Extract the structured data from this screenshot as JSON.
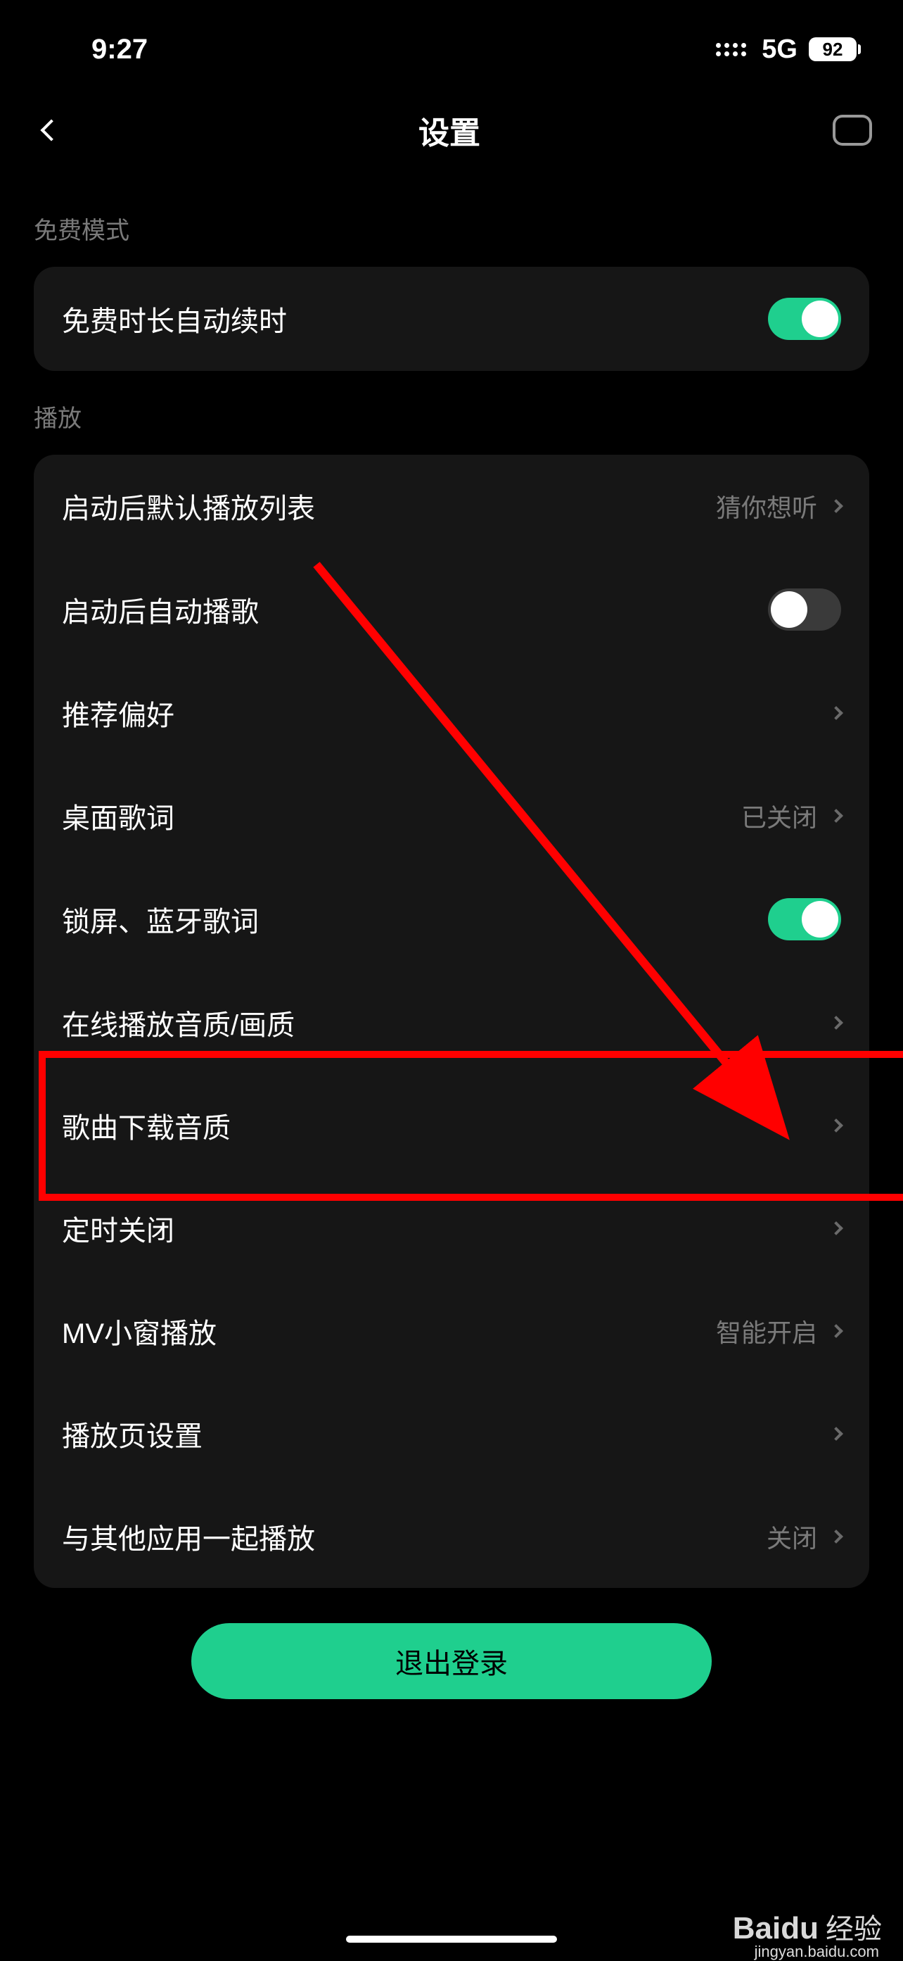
{
  "statusBar": {
    "time": "9:27",
    "network": "5G",
    "battery": "92"
  },
  "header": {
    "title": "设置"
  },
  "sections": {
    "free": {
      "title": "免费模式",
      "autoRenew": "免费时长自动续时"
    },
    "playback": {
      "title": "播放",
      "defaultPlaylist": {
        "label": "启动后默认播放列表",
        "value": "猜你想听"
      },
      "autoPlay": "启动后自动播歌",
      "preference": "推荐偏好",
      "desktopLyrics": {
        "label": "桌面歌词",
        "value": "已关闭"
      },
      "lockBtLyrics": "锁屏、蓝牙歌词",
      "onlineQuality": "在线播放音质/画质",
      "downloadQuality": "歌曲下载音质",
      "sleepTimer": "定时关闭",
      "mvPip": {
        "label": "MV小窗播放",
        "value": "智能开启"
      },
      "playerSettings": "播放页设置",
      "playWithOther": {
        "label": "与其他应用一起播放",
        "value": "关闭"
      }
    }
  },
  "logout": "退出登录",
  "watermark": {
    "brand": "Baidu",
    "text": "经验",
    "url": "jingyan.baidu.com"
  }
}
